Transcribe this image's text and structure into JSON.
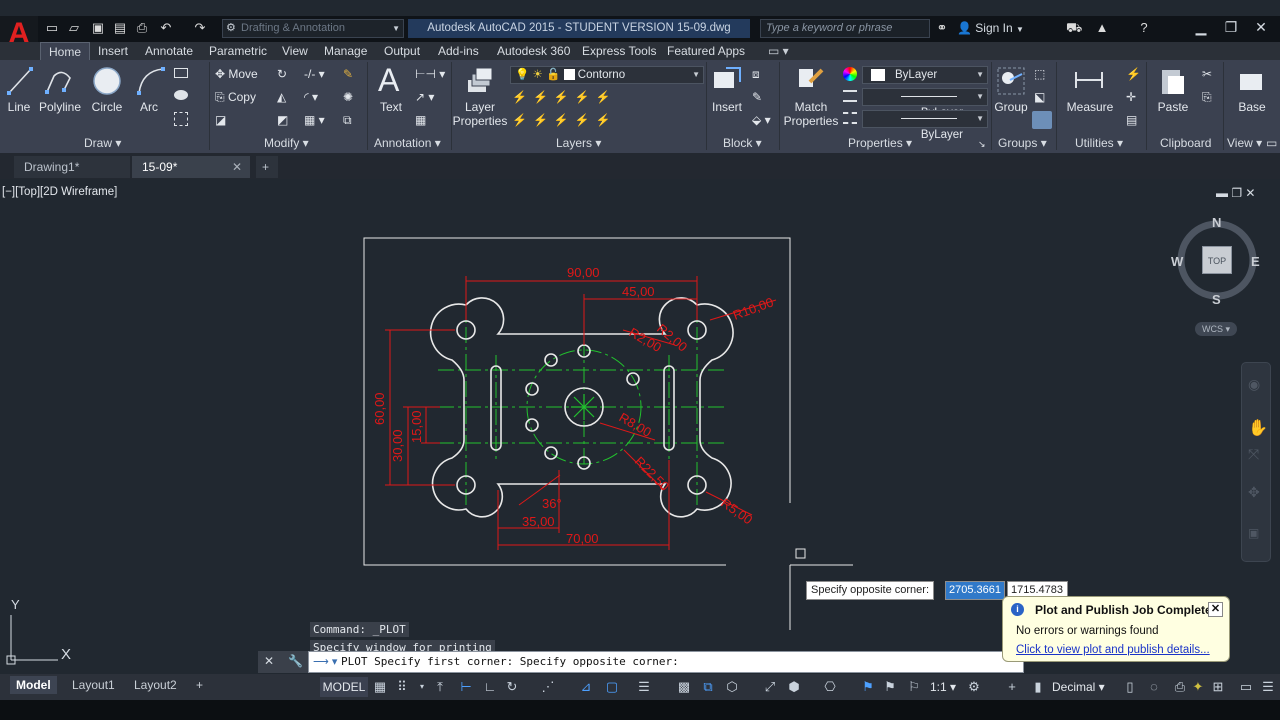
{
  "app": {
    "title": "Autodesk AutoCAD 2015 - STUDENT VERSION    15-09.dwg",
    "workspace": "Drafting & Annotation",
    "search_placeholder": "Type a keyword or phrase",
    "sign_in": "Sign In",
    "logo": "A"
  },
  "ribbon": {
    "tabs": [
      "Home",
      "Insert",
      "Annotate",
      "Parametric",
      "View",
      "Manage",
      "Output",
      "Add-ins",
      "Autodesk 360",
      "Express Tools",
      "Featured Apps"
    ],
    "active_tab": "Home",
    "draw": {
      "title": "Draw",
      "line": "Line",
      "polyline": "Polyline",
      "circle": "Circle",
      "arc": "Arc"
    },
    "modify": {
      "title": "Modify",
      "move": "Move",
      "copy": "Copy"
    },
    "annotation": {
      "title": "Annotation",
      "text": "Text"
    },
    "layers": {
      "title": "Layers",
      "layer_properties": "Layer\nProperties",
      "current_layer": "Contorno"
    },
    "block": {
      "title": "Block",
      "insert": "Insert"
    },
    "properties": {
      "title": "Properties",
      "match": "Match\nProperties",
      "color": "ByLayer",
      "linetype": "ByLayer",
      "lineweight": "ByLayer"
    },
    "groups": {
      "title": "Groups",
      "group": "Group"
    },
    "utilities": {
      "title": "Utilities",
      "measure": "Measure"
    },
    "clipboard": {
      "title": "Clipboard",
      "paste": "Paste"
    },
    "view": {
      "title": "View",
      "base": "Base"
    }
  },
  "doc_tabs": [
    "Drawing1*",
    "15-09*"
  ],
  "viewport_label": "[−][Top][2D Wireframe]",
  "viewcube": {
    "n": "N",
    "s": "S",
    "e": "E",
    "w": "W",
    "top": "TOP",
    "wcs": "WCS"
  },
  "dimensions": {
    "d90": "90,00",
    "d45": "45,00",
    "r10": "R10,00",
    "r2a": "R2,00",
    "r2b": "R2,00",
    "d60": "60,00",
    "d30": "30,00",
    "d15": "15,00",
    "r8": "R8,00",
    "r22": "R22,50",
    "a36": "36°",
    "d35": "35,00",
    "d70": "70,00",
    "r5": "R5,00"
  },
  "axes": {
    "x": "X",
    "y": "Y"
  },
  "command": {
    "history": [
      "Command: _PLOT",
      "Specify window for printing"
    ],
    "current": "PLOT Specify first corner: Specify opposite corner:"
  },
  "tooltip": {
    "prompt": "Specify opposite corner:",
    "x_value": "2705.3661",
    "y_value": "1715.4783"
  },
  "balloon": {
    "title": "Plot and Publish Job Complete",
    "message": "No errors or warnings found",
    "link": "Click to view plot and publish details..."
  },
  "status": {
    "layout_tabs": [
      "Model",
      "Layout1",
      "Layout2"
    ],
    "active_layout": "Model",
    "space": "MODEL",
    "scale": "1:1",
    "units": "Decimal"
  },
  "colors": {
    "geometry": "#e8e8e8",
    "dimension": "#e01818",
    "centerline": "#22c22e",
    "background": "#212830"
  }
}
